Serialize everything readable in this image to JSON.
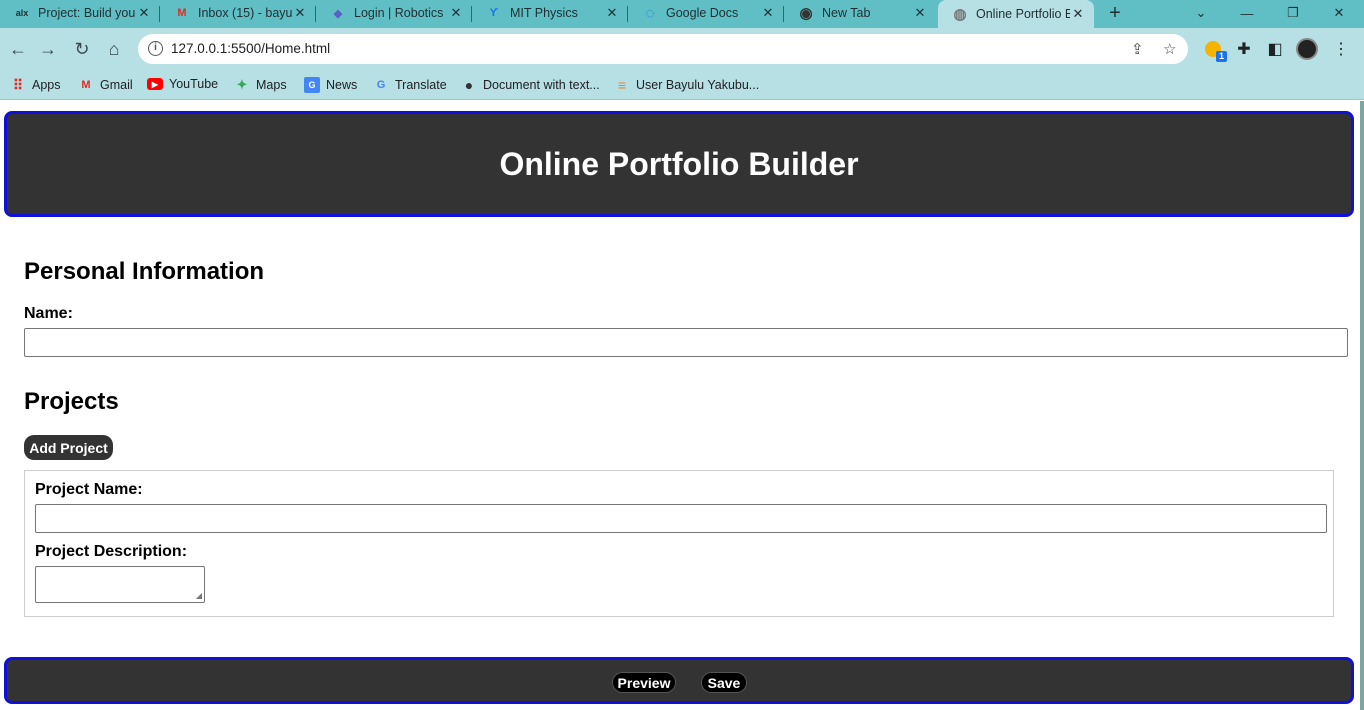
{
  "browser": {
    "tabs": [
      {
        "title": "Project: Build you",
        "favicon": "alx-icon",
        "fav_text": "alx",
        "fav_color": "#1f2f33"
      },
      {
        "title": "Inbox (15) - bayu",
        "favicon": "gmail-icon",
        "fav_text": "M",
        "fav_color": "#d93025"
      },
      {
        "title": "Login | Robotics",
        "favicon": "robotics-icon",
        "fav_text": "◆",
        "fav_color": "#5b5fc7"
      },
      {
        "title": "MIT Physics",
        "favicon": "mit-physics-icon",
        "fav_text": "ϒ",
        "fav_color": "#1a73e8"
      },
      {
        "title": "Google Docs",
        "favicon": "loading-icon",
        "fav_text": "◌",
        "fav_color": "#1a73e8"
      },
      {
        "title": "New Tab",
        "favicon": "chrome-icon",
        "fav_text": "◉",
        "fav_color": "#333333"
      },
      {
        "title": "Online Portfolio B",
        "favicon": "globe-icon",
        "fav_text": "◍",
        "fav_color": "#777777"
      }
    ],
    "url": "127.0.0.1:5500/Home.html",
    "extension_badge": "1",
    "bookmarks": [
      {
        "label": "Apps",
        "icon": "apps-grid-icon",
        "glyph": "⠿",
        "color": "#d93025"
      },
      {
        "label": "Gmail",
        "icon": "gmail-icon",
        "glyph": "M",
        "color": "#d93025"
      },
      {
        "label": "YouTube",
        "icon": "youtube-icon",
        "glyph": "▶",
        "color": "#ff0000"
      },
      {
        "label": "Maps",
        "icon": "maps-icon",
        "glyph": "✦",
        "color": "#34a853"
      },
      {
        "label": "News",
        "icon": "news-icon",
        "glyph": "G",
        "color": "#4285f4"
      },
      {
        "label": "Translate",
        "icon": "translate-icon",
        "glyph": "G",
        "color": "#4285f4"
      },
      {
        "label": "Document with text...",
        "icon": "globe-icon",
        "glyph": "●",
        "color": "#333333"
      },
      {
        "label": "User Bayulu Yakubu...",
        "icon": "stackoverflow-icon",
        "glyph": "≡",
        "color": "#f48024"
      }
    ]
  },
  "page": {
    "header_title": "Online Portfolio Builder",
    "personal_section_title": "Personal Information",
    "name_label": "Name:",
    "name_value": "",
    "projects_section_title": "Projects",
    "add_project_label": "Add Project",
    "project_name_label": "Project Name:",
    "project_name_value": "",
    "project_description_label": "Project Description:",
    "project_description_value": "",
    "footer": {
      "preview_label": "Preview",
      "save_label": "Save"
    }
  },
  "colors": {
    "accent_border": "#1010d8",
    "header_bg": "#333333",
    "tab_strip": "#5fbfc4",
    "toolbar": "#b7e0e5"
  }
}
